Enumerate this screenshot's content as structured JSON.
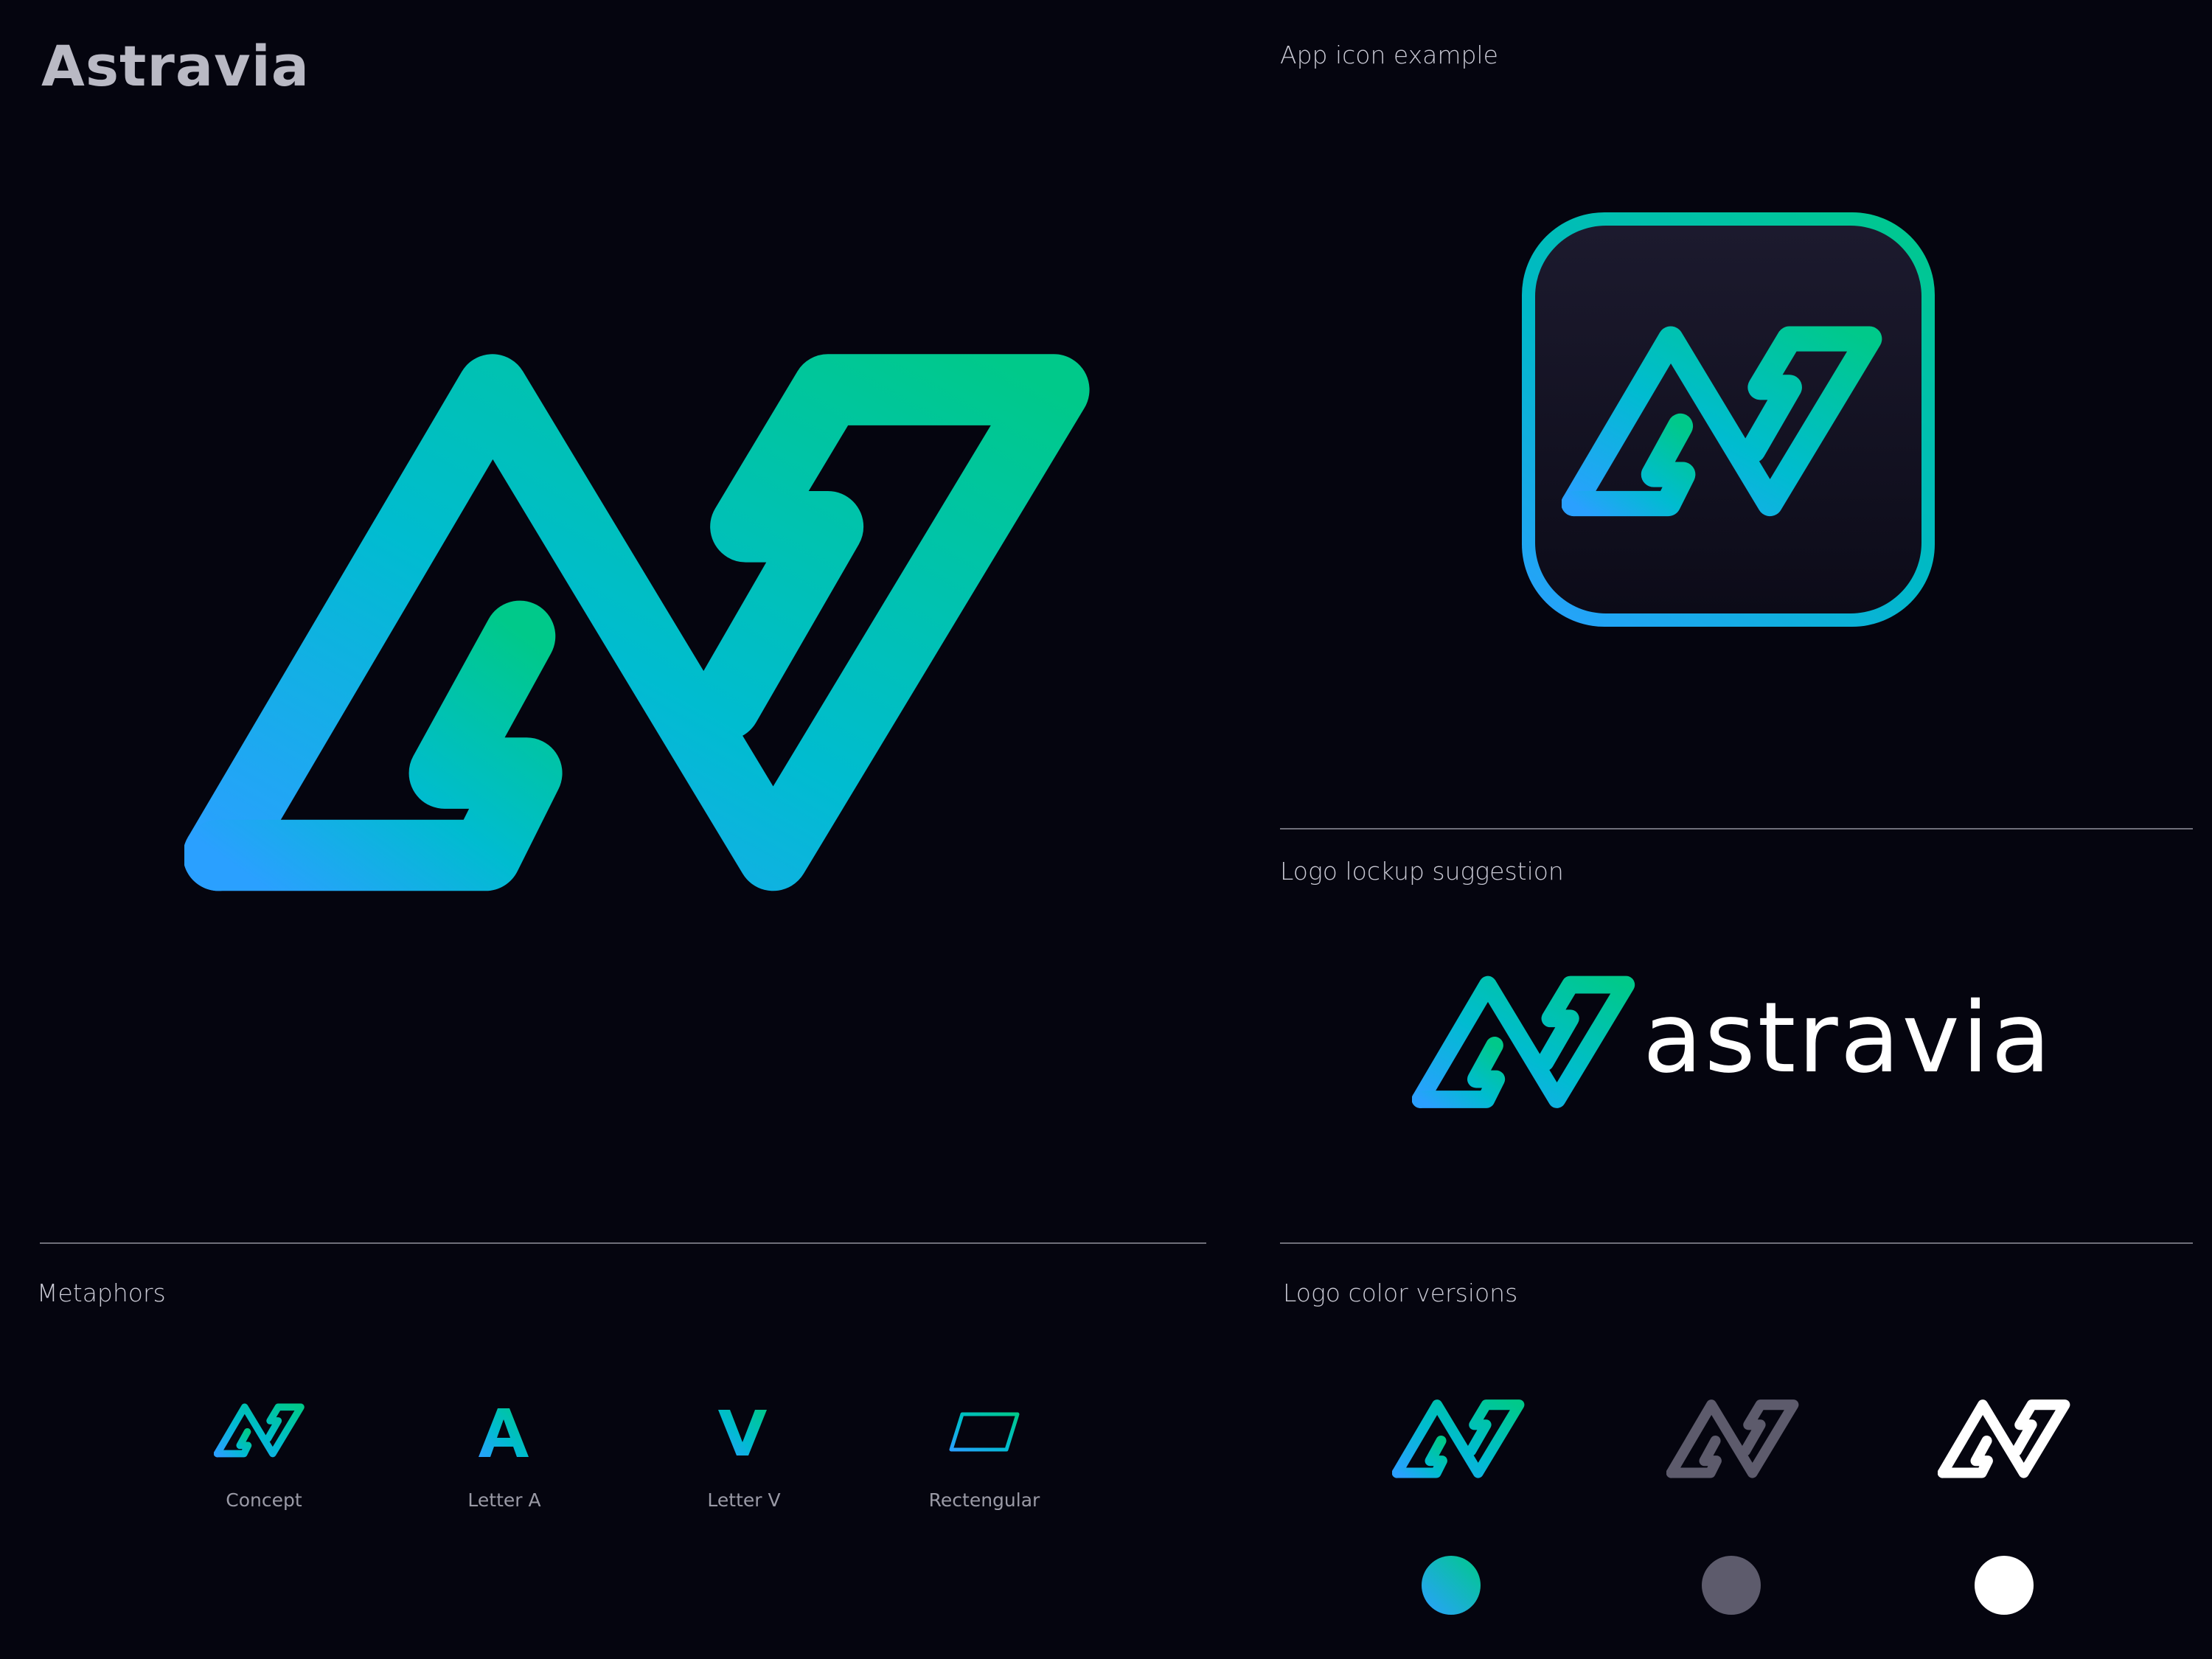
{
  "brand": {
    "title": "Astravia"
  },
  "sections": {
    "app_icon": "App icon example",
    "lockup": "Logo lockup suggestion",
    "metaphors": "Metaphors",
    "color_versions": "Logo color versions"
  },
  "lockup": {
    "wordmark": "astravia"
  },
  "metaphors": [
    {
      "label": "Concept",
      "icon": "av-monogram-icon"
    },
    {
      "label": "Letter A",
      "glyph": "A"
    },
    {
      "label": "Letter V",
      "glyph": "V"
    },
    {
      "label": "Rectengular",
      "icon": "parallelogram-icon"
    }
  ],
  "color_versions": [
    {
      "name": "gradient",
      "colors": [
        "#2aa0ff",
        "#00c98a"
      ]
    },
    {
      "name": "gray",
      "color": "#5d5b6c"
    },
    {
      "name": "white",
      "color": "#ffffff"
    }
  ],
  "colors": {
    "background": "#05050f",
    "gradient_start": "#2aa0ff",
    "gradient_end": "#00c98a",
    "gray": "#5d5b6c",
    "white": "#ffffff"
  }
}
